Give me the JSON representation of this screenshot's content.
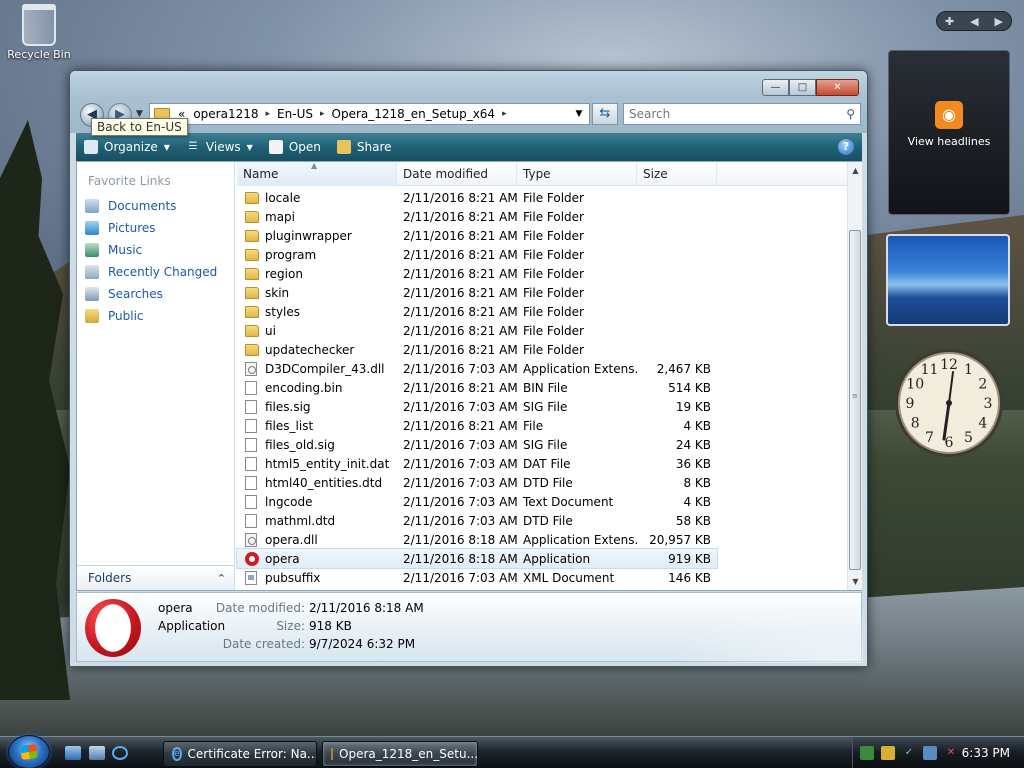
{
  "desktop": {
    "recycle_bin_label": "Recycle Bin"
  },
  "gadgets": {
    "feed_label": "View headlines",
    "clock_numbers": [
      "12",
      "1",
      "2",
      "3",
      "4",
      "5",
      "6",
      "7",
      "8",
      "9",
      "10",
      "11"
    ]
  },
  "window": {
    "tooltip": "Back to En-US",
    "breadcrumb_overflow": "«",
    "breadcrumbs": [
      "opera1218",
      "En-US",
      "Opera_1218_en_Setup_x64"
    ],
    "search_placeholder": "Search",
    "buttons": {
      "minimize": "—",
      "maximize": "□",
      "close": "✕"
    }
  },
  "toolbar": {
    "organize": "Organize",
    "views": "Views",
    "open": "Open",
    "share": "Share",
    "help": "?"
  },
  "nav_pane": {
    "title": "Favorite Links",
    "links": [
      "Documents",
      "Pictures",
      "Music",
      "Recently Changed",
      "Searches",
      "Public"
    ],
    "folders_label": "Folders"
  },
  "columns": {
    "name": "Name",
    "date": "Date modified",
    "type": "Type",
    "size": "Size"
  },
  "files": [
    {
      "name": "locale",
      "date": "2/11/2016 8:21 AM",
      "type": "File Folder",
      "size": "",
      "icon": "folder"
    },
    {
      "name": "mapi",
      "date": "2/11/2016 8:21 AM",
      "type": "File Folder",
      "size": "",
      "icon": "folder"
    },
    {
      "name": "pluginwrapper",
      "date": "2/11/2016 8:21 AM",
      "type": "File Folder",
      "size": "",
      "icon": "folder"
    },
    {
      "name": "program",
      "date": "2/11/2016 8:21 AM",
      "type": "File Folder",
      "size": "",
      "icon": "folder"
    },
    {
      "name": "region",
      "date": "2/11/2016 8:21 AM",
      "type": "File Folder",
      "size": "",
      "icon": "folder"
    },
    {
      "name": "skin",
      "date": "2/11/2016 8:21 AM",
      "type": "File Folder",
      "size": "",
      "icon": "folder"
    },
    {
      "name": "styles",
      "date": "2/11/2016 8:21 AM",
      "type": "File Folder",
      "size": "",
      "icon": "folder"
    },
    {
      "name": "ui",
      "date": "2/11/2016 8:21 AM",
      "type": "File Folder",
      "size": "",
      "icon": "folder"
    },
    {
      "name": "updatechecker",
      "date": "2/11/2016 8:21 AM",
      "type": "File Folder",
      "size": "",
      "icon": "folder"
    },
    {
      "name": "D3DCompiler_43.dll",
      "date": "2/11/2016 7:03 AM",
      "type": "Application Extens...",
      "size": "2,467 KB",
      "icon": "dll"
    },
    {
      "name": "encoding.bin",
      "date": "2/11/2016 8:21 AM",
      "type": "BIN File",
      "size": "514 KB",
      "icon": "file"
    },
    {
      "name": "files.sig",
      "date": "2/11/2016 7:03 AM",
      "type": "SIG File",
      "size": "19 KB",
      "icon": "file"
    },
    {
      "name": "files_list",
      "date": "2/11/2016 8:21 AM",
      "type": "File",
      "size": "4 KB",
      "icon": "file"
    },
    {
      "name": "files_old.sig",
      "date": "2/11/2016 7:03 AM",
      "type": "SIG File",
      "size": "24 KB",
      "icon": "file"
    },
    {
      "name": "html5_entity_init.dat",
      "date": "2/11/2016 7:03 AM",
      "type": "DAT File",
      "size": "36 KB",
      "icon": "file"
    },
    {
      "name": "html40_entities.dtd",
      "date": "2/11/2016 7:03 AM",
      "type": "DTD File",
      "size": "8 KB",
      "icon": "file"
    },
    {
      "name": "lngcode",
      "date": "2/11/2016 7:03 AM",
      "type": "Text Document",
      "size": "4 KB",
      "icon": "file"
    },
    {
      "name": "mathml.dtd",
      "date": "2/11/2016 7:03 AM",
      "type": "DTD File",
      "size": "58 KB",
      "icon": "file"
    },
    {
      "name": "opera.dll",
      "date": "2/11/2016 8:18 AM",
      "type": "Application Extens...",
      "size": "20,957 KB",
      "icon": "dll"
    },
    {
      "name": "opera",
      "date": "2/11/2016 8:18 AM",
      "type": "Application",
      "size": "919 KB",
      "icon": "opera",
      "selected": true
    },
    {
      "name": "pubsuffix",
      "date": "2/11/2016 7:03 AM",
      "type": "XML Document",
      "size": "146 KB",
      "icon": "xml"
    }
  ],
  "details": {
    "name": "opera",
    "kind": "Application",
    "modified_label": "Date modified:",
    "modified_value": "2/11/2016 8:18 AM",
    "size_label": "Size:",
    "size_value": "918 KB",
    "created_label": "Date created:",
    "created_value": "9/7/2024 6:32 PM"
  },
  "taskbar": {
    "tasks": [
      "Certificate Error: Na...",
      "Opera_1218_en_Setu..."
    ],
    "clock": "6:33 PM"
  },
  "colors": {
    "link_blue": "#1b5aa8",
    "toolbar_teal": "#1f6176",
    "opera_red": "#d31a21"
  }
}
